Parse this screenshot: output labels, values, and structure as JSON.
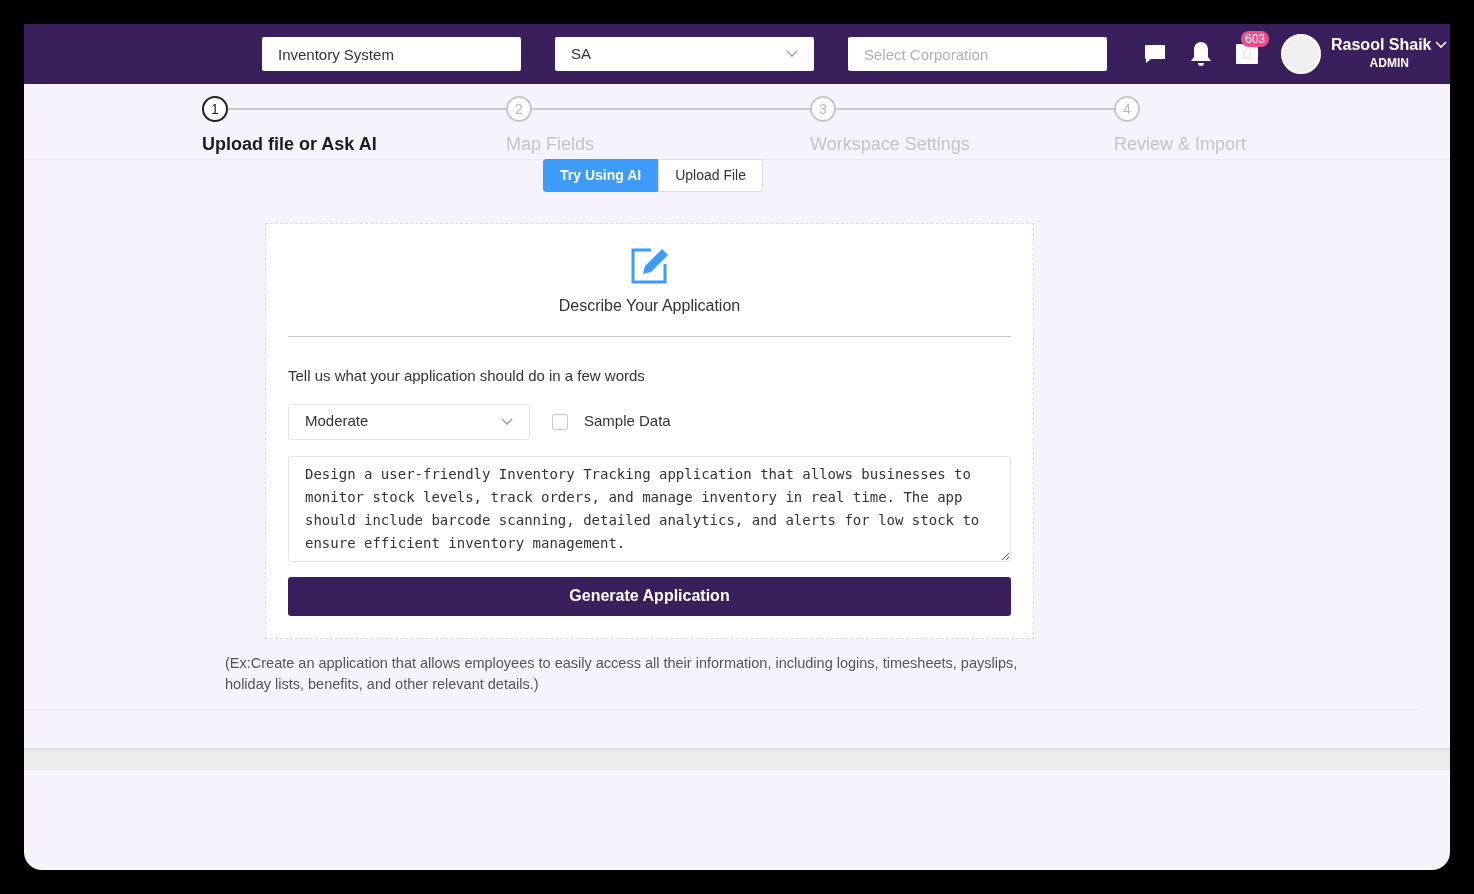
{
  "header": {
    "app_field": "Inventory System",
    "region_select": "SA",
    "corporation_field": {
      "placeholder": "Select Corporation"
    },
    "notification_count": "603",
    "user": {
      "name": "Rasool Shaik",
      "role": "ADMIN"
    }
  },
  "steps": [
    {
      "number": "1",
      "label": "Upload file or Ask AI",
      "selected": true
    },
    {
      "number": "2",
      "label": "Map Fields",
      "selected": false
    },
    {
      "number": "3",
      "label": "Workspace Settings",
      "selected": false
    },
    {
      "number": "4",
      "label": "Review & Import",
      "selected": false
    }
  ],
  "tabs": [
    {
      "label": "Try Using AI",
      "selected": true
    },
    {
      "label": "Upload File",
      "selected": false
    }
  ],
  "card": {
    "title": "Describe Your Application",
    "prompt_label": "Tell us what your application should do in a few words",
    "complexity_select": "Moderate",
    "sample_data": {
      "label": "Sample Data",
      "checked": false
    },
    "description": "Design a user-friendly Inventory Tracking application that allows businesses to monitor stock levels, track orders, and manage inventory in real time. The app should include barcode scanning, detailed analytics, and alerts for low stock to ensure efficient inventory management.",
    "generate_button": "Generate Application"
  },
  "example_text": "(Ex:Create an application that allows employees to easily access all their information, including logins, timesheets, payslips, holiday lists, benefits, and other relevant details.)"
}
